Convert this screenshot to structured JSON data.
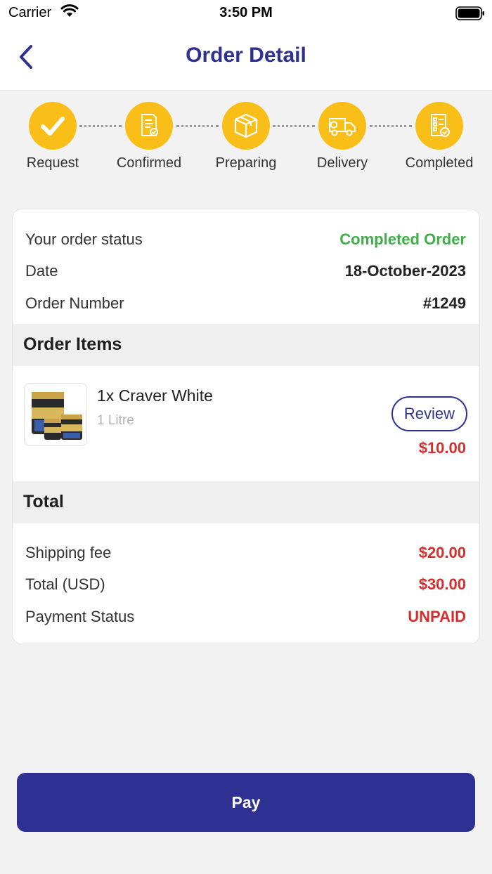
{
  "status_bar": {
    "carrier": "Carrier",
    "time": "3:50 PM"
  },
  "header": {
    "title": "Order Detail"
  },
  "steps": [
    {
      "label": "Request",
      "icon": "check-icon"
    },
    {
      "label": "Confirmed",
      "icon": "document-check-icon"
    },
    {
      "label": "Preparing",
      "icon": "box-icon"
    },
    {
      "label": "Delivery",
      "icon": "truck-icon"
    },
    {
      "label": "Completed",
      "icon": "checklist-icon"
    }
  ],
  "order": {
    "status_label": "Your order status",
    "status_value": "Completed Order",
    "date_label": "Date",
    "date_value": "18-October-2023",
    "number_label": "Order Number",
    "number_value": "#1249"
  },
  "items_section": {
    "title": "Order Items",
    "items": [
      {
        "qty": "1x",
        "name": "Craver White",
        "variant": "1 Litre",
        "review_label": "Review",
        "price": "$10.00"
      }
    ]
  },
  "total_section": {
    "title": "Total",
    "shipping_label": "Shipping fee",
    "shipping_value": "$20.00",
    "total_label": "Total (USD)",
    "total_value": "$30.00",
    "payment_label": "Payment Status",
    "payment_value": "UNPAID"
  },
  "pay_button": "Pay",
  "colors": {
    "brand": "#2e3192",
    "step_yellow": "#f9be17",
    "success_green": "#3fae49",
    "price_red": "#d32f2f"
  }
}
